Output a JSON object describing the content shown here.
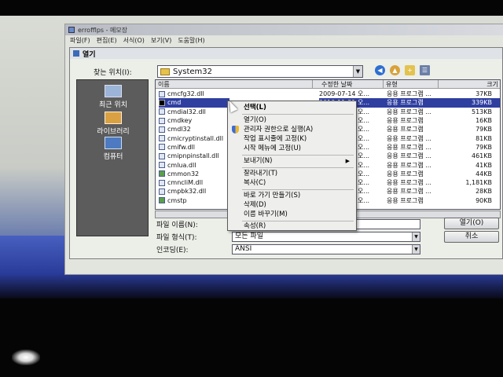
{
  "notepad": {
    "title": "errofflps - 메모장",
    "menu": [
      "파일(F)",
      "편집(E)",
      "서식(O)",
      "보기(V)",
      "도움말(H)"
    ]
  },
  "dialog": {
    "title": "열기",
    "look_in_label": "찾는 위치(I):",
    "look_in_value": "System32",
    "places": [
      {
        "label": "최근 위치",
        "icon": "recent-places-icon"
      },
      {
        "label": "라이브러리",
        "icon": "libraries-icon"
      },
      {
        "label": "컴퓨터",
        "icon": "computer-icon"
      }
    ],
    "columns": [
      "이름",
      "수정한 날짜",
      "유형",
      "크기"
    ],
    "files": [
      {
        "name": "cmcfg32.dll",
        "date": "2009-07-14 오...",
        "type": "응용 프로그램 ...",
        "size": "37KB"
      },
      {
        "name": "cmd",
        "date": "2010-11-21 오...",
        "type": "응용 프로그램",
        "size": "339KB"
      },
      {
        "name": "cmdial32.dll",
        "date": "2009-07-14 오...",
        "type": "응용 프로그램 ...",
        "size": "513KB"
      },
      {
        "name": "cmdkey",
        "date": "2009-07-14 오...",
        "type": "응용 프로그램",
        "size": "16KB"
      },
      {
        "name": "cmdl32",
        "date": "2009-07-14 오...",
        "type": "응용 프로그램",
        "size": "79KB"
      },
      {
        "name": "cmicryptinstall.dll",
        "date": "2009-07-14 오...",
        "type": "응용 프로그램 ...",
        "size": "81KB"
      },
      {
        "name": "cmifw.dll",
        "date": "2009-07-14 오...",
        "type": "응용 프로그램 ...",
        "size": "79KB"
      },
      {
        "name": "cmipnpinstall.dll",
        "date": "2009-07-14 오...",
        "type": "응용 프로그램 ...",
        "size": "461KB"
      },
      {
        "name": "cmlua.dll",
        "date": "2009-07-14 오...",
        "type": "응용 프로그램 ...",
        "size": "41KB"
      },
      {
        "name": "cmmon32",
        "date": "2009-07-14 오...",
        "type": "응용 프로그램",
        "size": "44KB"
      },
      {
        "name": "cmncliM.dll",
        "date": "2009-07-14 오...",
        "type": "응용 프로그램 ...",
        "size": "1,181KB"
      },
      {
        "name": "cmpbk32.dll",
        "date": "2009-07-14 오...",
        "type": "응용 프로그램 ...",
        "size": "28KB"
      },
      {
        "name": "cmstp",
        "date": "2009-07-14 오...",
        "type": "응용 프로그램",
        "size": "90KB"
      }
    ],
    "filename_label": "파일 이름(N):",
    "filename_value": "",
    "filetype_label": "파일 형식(T):",
    "filetype_value": "모든 파일",
    "encoding_label": "인코딩(E):",
    "encoding_value": "ANSI",
    "open_button": "열기(O)",
    "cancel_button": "취소"
  },
  "context_menu": {
    "items": [
      {
        "label": "선택(L)",
        "bold": true
      },
      {
        "label": "열기(O)"
      },
      {
        "label": "관리자 권한으로 실행(A)",
        "icon": "uac-shield-icon"
      },
      {
        "label": "작업 표시줄에 고정(K)"
      },
      {
        "label": "시작 메뉴에 고정(U)"
      },
      {
        "label": "보내기(N)",
        "submenu": true
      },
      {
        "label": "잘라내기(T)"
      },
      {
        "label": "복사(C)"
      },
      {
        "label": "바로 가기 만들기(S)"
      },
      {
        "label": "삭제(D)"
      },
      {
        "label": "이름 바꾸기(M)"
      },
      {
        "label": "속성(R)"
      }
    ]
  }
}
